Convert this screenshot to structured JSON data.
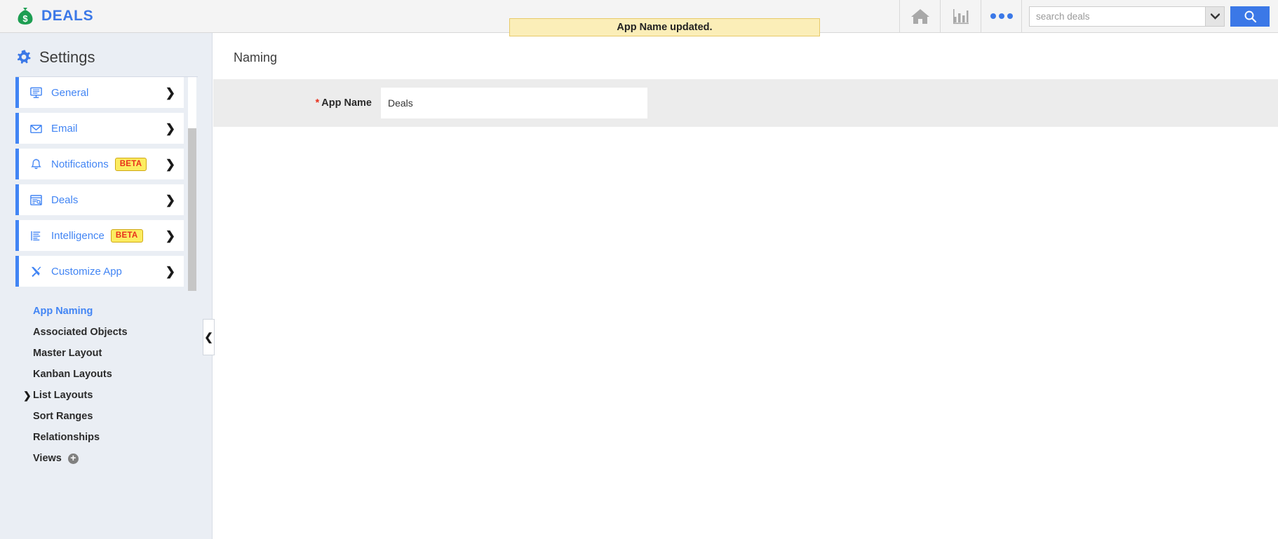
{
  "app": {
    "brand_name": "DEALS",
    "brand_icon": "money-bag-icon",
    "brand_color": "#3b78e7"
  },
  "topbar": {
    "notification": {
      "message": "App Name updated.",
      "background": "#fbeeb8",
      "border": "#e8ca6a"
    },
    "icons": [
      {
        "name": "home-icon",
        "label": "Home"
      },
      {
        "name": "reports-chart-icon",
        "label": "Reports"
      },
      {
        "name": "more-options-icon",
        "label": "More"
      }
    ],
    "search": {
      "placeholder": "search deals",
      "value": "",
      "dropdown_icon": "chevron-down-icon",
      "button_icon": "search-icon",
      "button_color": "#3b78e7"
    }
  },
  "sidebar": {
    "title": "Settings",
    "title_icon": "gear-icon",
    "nav_items": [
      {
        "label": "General",
        "icon": "monitor-icon",
        "badge": null,
        "chevron": "chevron-right-icon"
      },
      {
        "label": "Email",
        "icon": "envelope-icon",
        "badge": null,
        "chevron": "chevron-right-icon"
      },
      {
        "label": "Notifications",
        "icon": "bell-icon",
        "badge": "BETA",
        "chevron": "chevron-right-icon"
      },
      {
        "label": "Deals",
        "icon": "window-search-icon",
        "badge": null,
        "chevron": "chevron-right-icon"
      },
      {
        "label": "Intelligence",
        "icon": "document-lines-icon",
        "badge": "BETA",
        "chevron": "chevron-right-icon"
      },
      {
        "label": "Customize App",
        "icon": "tools-icon",
        "badge": null,
        "chevron": "chevron-down-icon"
      }
    ],
    "sub_items": [
      {
        "label": "App Naming",
        "active": true,
        "chevron": null,
        "plus": false
      },
      {
        "label": "Associated Objects",
        "active": false,
        "chevron": null,
        "plus": false
      },
      {
        "label": "Master Layout",
        "active": false,
        "chevron": null,
        "plus": false
      },
      {
        "label": "Kanban Layouts",
        "active": false,
        "chevron": null,
        "plus": false
      },
      {
        "label": "List Layouts",
        "active": false,
        "chevron": "chevron-right-icon",
        "plus": false
      },
      {
        "label": "Sort Ranges",
        "active": false,
        "chevron": null,
        "plus": false
      },
      {
        "label": "Relationships",
        "active": false,
        "chevron": null,
        "plus": false
      },
      {
        "label": "Views",
        "active": false,
        "chevron": null,
        "plus": true
      }
    ],
    "collapse_handle_icon": "chevron-left-icon",
    "active_color": "#4285f4",
    "beta_badge_bg": "#fcec61",
    "beta_badge_text_color": "#e8301c"
  },
  "main": {
    "page_title": "Naming",
    "form": {
      "required_marker": "*",
      "field_label": "App Name",
      "field_value": "Deals",
      "field_placeholder": "",
      "row_background": "#ececec"
    }
  }
}
